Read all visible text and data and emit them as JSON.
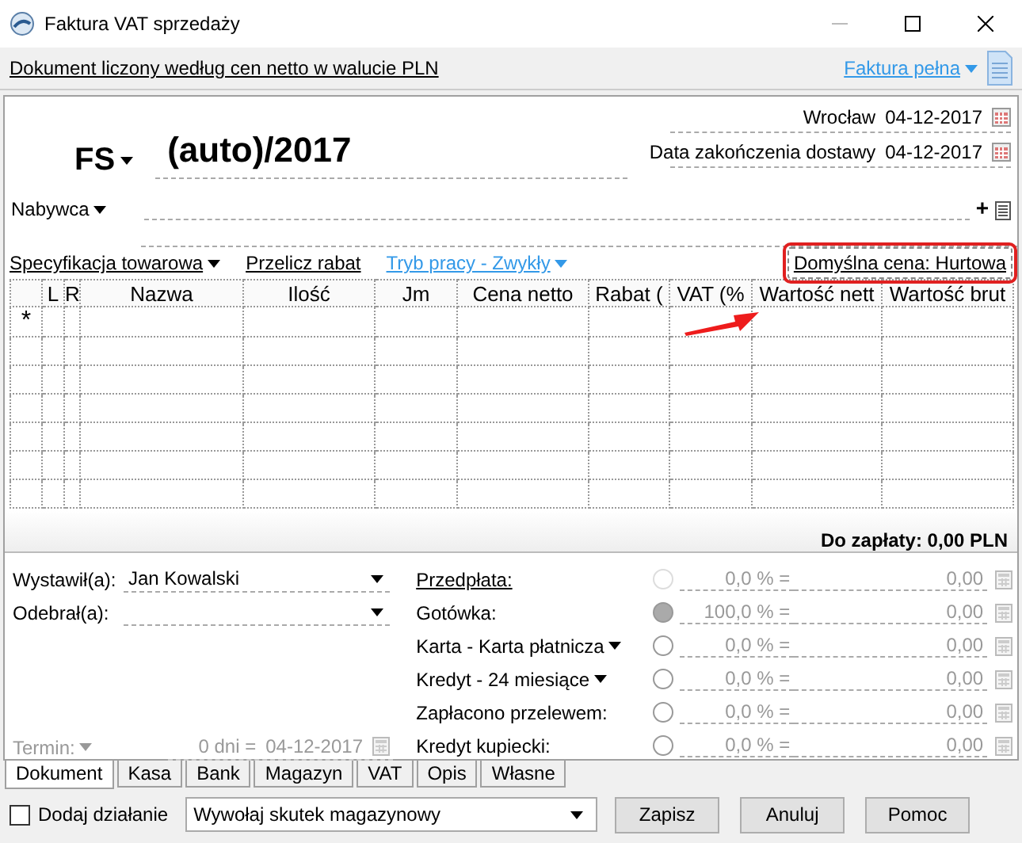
{
  "window": {
    "title": "Faktura VAT sprzedaży"
  },
  "info_bar": {
    "note": "Dokument liczony według cen netto w walucie PLN",
    "type_link": "Faktura pełna"
  },
  "header": {
    "doc_type": "FS",
    "number": "(auto)/2017",
    "place": "Wrocław",
    "date": "04-12-2017",
    "delivery_label": "Data zakończenia dostawy",
    "delivery_date": "04-12-2017",
    "buyer_label": "Nabywca",
    "buyer_add": "+"
  },
  "toolbar": [
    {
      "text": "Specyfikacja towarowa",
      "kind": "menu"
    },
    {
      "text": "Przelicz rabat",
      "kind": "link"
    },
    {
      "text": "Tryb pracy - Zwykły",
      "kind": "blue-menu"
    }
  ],
  "default_price": {
    "text": "Domyślna cena: Hurtowa",
    "highlighted": true
  },
  "table": {
    "columns": [
      "",
      "L",
      "R",
      "Nazwa",
      "Ilość",
      "Jm",
      "Cena netto",
      "Rabat (",
      "VAT (%",
      "Wartość nett",
      "Wartość brut"
    ],
    "rows": [
      {
        "marker": "*"
      }
    ]
  },
  "total": "Do zapłaty: 0,00 PLN",
  "people": [
    {
      "label": "Wystawił(a):",
      "value": "Jan Kowalski"
    },
    {
      "label": "Odebrał(a):"
    }
  ],
  "term": {
    "label": "Termin:",
    "days": "0 dni =",
    "date": "04-12-2017",
    "disabled": true
  },
  "payments": [
    {
      "label": "Przedpłata:",
      "kind": "link",
      "selected": false,
      "disabled": true,
      "percent": "0,0 % =",
      "amount": "0,00"
    },
    {
      "label": "Gotówka:",
      "kind": "label",
      "selected": true,
      "disabled": false,
      "percent": "100,0 % =",
      "amount": "0,00"
    },
    {
      "label": "Karta - Karta płatnicza",
      "kind": "menu",
      "selected": false,
      "disabled": false,
      "percent": "0,0 % =",
      "amount": "0,00"
    },
    {
      "label": "Kredyt - 24 miesiące",
      "kind": "menu",
      "selected": false,
      "disabled": false,
      "percent": "0,0 % =",
      "amount": "0,00"
    },
    {
      "label": "Zapłacono przelewem:",
      "kind": "label",
      "selected": false,
      "disabled": false,
      "percent": "0,0 % =",
      "amount": "0,00"
    },
    {
      "label": "Kredyt kupiecki:",
      "kind": "label",
      "selected": false,
      "disabled": false,
      "percent": "0,0 % =",
      "amount": "0,00"
    }
  ],
  "tabs": [
    {
      "label": "Dokument",
      "selected": true
    },
    {
      "label": "Kasa",
      "selected": false
    },
    {
      "label": "Bank",
      "selected": false
    },
    {
      "label": "Magazyn",
      "selected": false
    },
    {
      "label": "VAT",
      "selected": false
    },
    {
      "label": "Opis",
      "selected": false
    },
    {
      "label": "Własne",
      "selected": false
    }
  ],
  "footer": {
    "checkbox_label": "Dodaj działanie",
    "checked": false,
    "action": "Wywołaj skutek magazynowy",
    "buttons": [
      "Zapisz",
      "Anuluj",
      "Pomoc"
    ]
  }
}
